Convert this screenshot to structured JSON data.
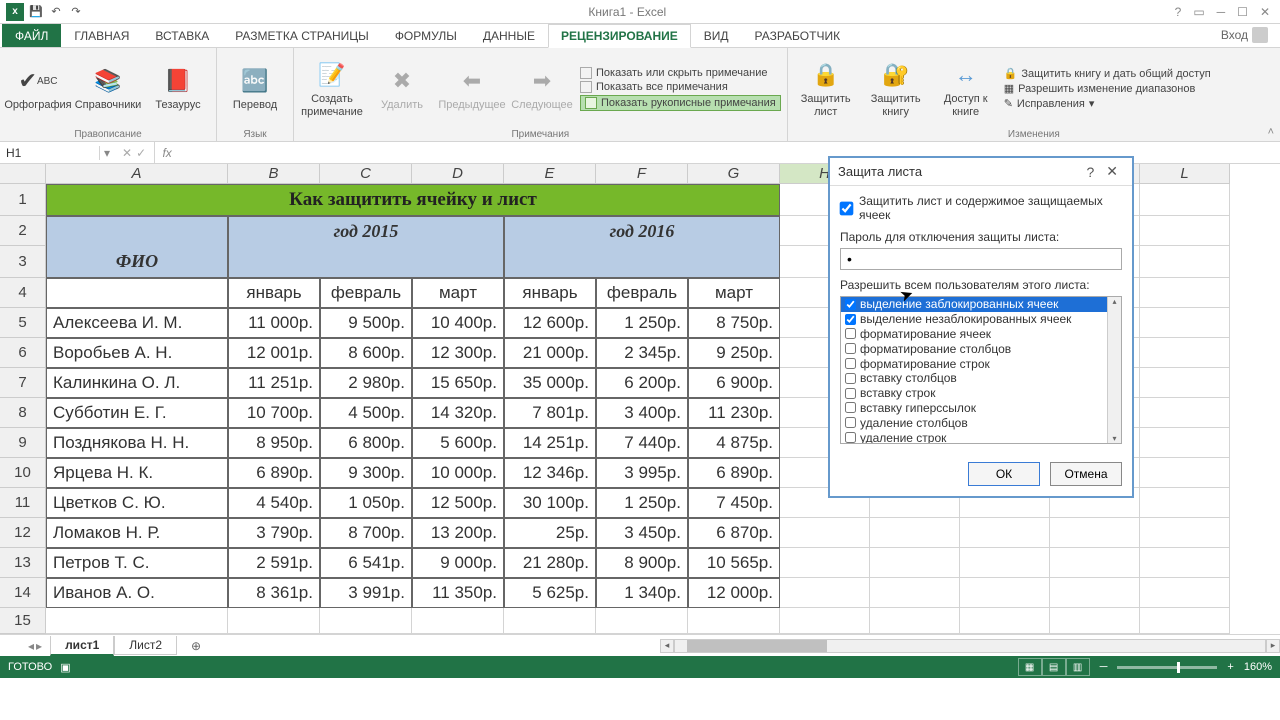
{
  "title": "Книга1 - Excel",
  "login": "Вход",
  "tabs": [
    "ФАЙЛ",
    "ГЛАВНАЯ",
    "ВСТАВКА",
    "РАЗМЕТКА СТРАНИЦЫ",
    "ФОРМУЛЫ",
    "ДАННЫЕ",
    "РЕЦЕНЗИРОВАНИЕ",
    "ВИД",
    "РАЗРАБОТЧИК"
  ],
  "activeTab": 6,
  "ribbon": {
    "g1": {
      "label": "Правописание",
      "b": [
        "Орфография",
        "Справочники",
        "Тезаурус"
      ]
    },
    "g2": {
      "label": "Язык",
      "b": [
        "Перевод"
      ]
    },
    "g3": {
      "label": "Примечания",
      "b": [
        "Создать примечание",
        "Удалить",
        "Предыдущее",
        "Следующее"
      ],
      "chk": [
        "Показать или скрыть примечание",
        "Показать все примечания",
        "Показать рукописные примечания"
      ]
    },
    "g4": {
      "label": "Изменения",
      "b": [
        "Защитить лист",
        "Защитить книгу",
        "Доступ к книге"
      ],
      "s": [
        "Защитить книгу и дать общий доступ",
        "Разрешить изменение диапазонов",
        "Исправления"
      ]
    }
  },
  "nameBox": "H1",
  "cols": [
    "A",
    "B",
    "C",
    "D",
    "E",
    "F",
    "G",
    "H",
    "I",
    "J",
    "K",
    "L"
  ],
  "titleRow": "Как защитить ячейку и лист",
  "fioHdr": "ФИО",
  "year1": "год 2015",
  "year2": "год 2016",
  "months": [
    "январь",
    "февраль",
    "март",
    "январь",
    "февраль",
    "март"
  ],
  "data": [
    {
      "n": "Алексеева И. М.",
      "v": [
        "11 000р.",
        "9 500р.",
        "10 400р.",
        "12 600р.",
        "1 250р.",
        "8 750р."
      ]
    },
    {
      "n": "Воробьев А. Н.",
      "v": [
        "12 001р.",
        "8 600р.",
        "12 300р.",
        "21 000р.",
        "2 345р.",
        "9 250р."
      ]
    },
    {
      "n": "Калинкина О. Л.",
      "v": [
        "11 251р.",
        "2 980р.",
        "15 650р.",
        "35 000р.",
        "6 200р.",
        "6 900р."
      ]
    },
    {
      "n": "Субботин Е. Г.",
      "v": [
        "10 700р.",
        "4 500р.",
        "14 320р.",
        "7 801р.",
        "3 400р.",
        "11 230р."
      ]
    },
    {
      "n": "Позднякова Н. Н.",
      "v": [
        "8 950р.",
        "6 800р.",
        "5 600р.",
        "14 251р.",
        "7 440р.",
        "4 875р."
      ]
    },
    {
      "n": "Ярцева Н. К.",
      "v": [
        "6 890р.",
        "9 300р.",
        "10 000р.",
        "12 346р.",
        "3 995р.",
        "6 890р."
      ]
    },
    {
      "n": "Цветков С. Ю.",
      "v": [
        "4 540р.",
        "1 050р.",
        "12 500р.",
        "30 100р.",
        "1 250р.",
        "7 450р."
      ]
    },
    {
      "n": "Ломаков Н. Р.",
      "v": [
        "3 790р.",
        "8 700р.",
        "13 200р.",
        "25р.",
        "3 450р.",
        "6 870р."
      ]
    },
    {
      "n": "Петров Т. С.",
      "v": [
        "2 591р.",
        "6 541р.",
        "9 000р.",
        "21 280р.",
        "8 900р.",
        "10 565р."
      ]
    },
    {
      "n": "Иванов А. О.",
      "v": [
        "8 361р.",
        "3 991р.",
        "11 350р.",
        "5 625р.",
        "1 340р.",
        "12 000р."
      ]
    }
  ],
  "sheets": [
    "лист1",
    "Лист2"
  ],
  "status": "ГОТОВО",
  "zoom": "160%",
  "dialog": {
    "title": "Защита листа",
    "chk1": "Защитить лист и содержимое защищаемых ячеек",
    "pwLabel": "Пароль для отключения защиты листа:",
    "pwValue": "•",
    "permLabel": "Разрешить всем пользователям этого листа:",
    "items": [
      {
        "t": "выделение заблокированных ячеек",
        "c": true,
        "sel": true
      },
      {
        "t": "выделение незаблокированных ячеек",
        "c": true
      },
      {
        "t": "форматирование ячеек",
        "c": false
      },
      {
        "t": "форматирование столбцов",
        "c": false
      },
      {
        "t": "форматирование строк",
        "c": false
      },
      {
        "t": "вставку столбцов",
        "c": false
      },
      {
        "t": "вставку строк",
        "c": false
      },
      {
        "t": "вставку гиперссылок",
        "c": false
      },
      {
        "t": "удаление столбцов",
        "c": false
      },
      {
        "t": "удаление строк",
        "c": false
      }
    ],
    "ok": "ОК",
    "cancel": "Отмена"
  }
}
